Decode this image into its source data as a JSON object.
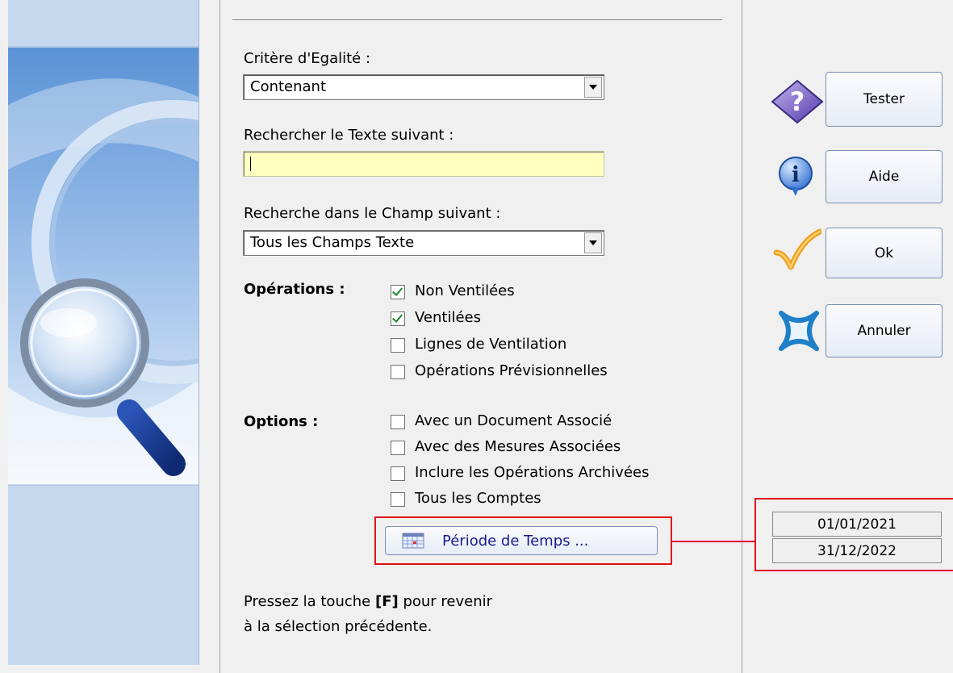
{
  "form": {
    "equality_label": "Critère d'Egalité :",
    "equality_value": "Contenant",
    "search_text_label": "Rechercher le Texte suivant :",
    "search_text_value": "",
    "field_label": "Recherche dans le Champ suivant :",
    "field_value": "Tous les Champs Texte"
  },
  "operations": {
    "label": "Opérations :",
    "items": [
      {
        "label": "Non Ventilées",
        "checked": true
      },
      {
        "label": "Ventilées",
        "checked": true
      },
      {
        "label": "Lignes de Ventilation",
        "checked": false
      },
      {
        "label": "Opérations Prévisionnelles",
        "checked": false
      }
    ]
  },
  "options": {
    "label": "Options :",
    "items": [
      {
        "label": "Avec un Document Associé",
        "checked": false
      },
      {
        "label": "Avec des Mesures Associées",
        "checked": false
      },
      {
        "label": "Inclure les Opérations Archivées",
        "checked": false
      },
      {
        "label": "Tous les Comptes",
        "checked": false
      }
    ]
  },
  "period": {
    "button_label": "Période de Temps ...",
    "start_date": "01/01/2021",
    "end_date": "31/12/2022"
  },
  "hint": {
    "prefix": "Pressez la touche",
    "key": "[F]",
    "suffix": "pour revenir",
    "line2": "à la sélection précédente."
  },
  "buttons": {
    "test": "Tester",
    "help": "Aide",
    "ok": "Ok",
    "cancel": "Annuler"
  },
  "colors": {
    "highlight_red": "#e0101a",
    "search_field_bg": "#ffffc0",
    "check_green": "#1d8a2c",
    "link_blue": "#1a1a8c"
  }
}
